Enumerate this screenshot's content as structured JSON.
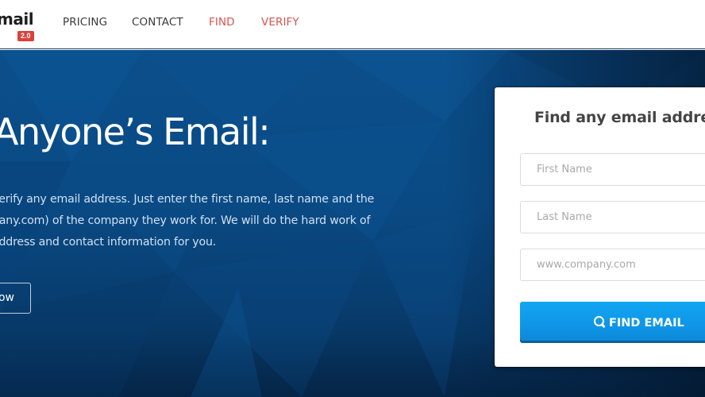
{
  "header": {
    "logo": {
      "text": "mail",
      "badge": "2.0"
    },
    "nav": [
      {
        "label": "PRICING",
        "accent": false
      },
      {
        "label": "CONTACT",
        "accent": false
      },
      {
        "label": "FIND",
        "accent": true
      },
      {
        "label": "VERIFY",
        "accent": true
      }
    ]
  },
  "hero": {
    "title": "Anyone’s Email:",
    "description": [
      "verify any email address. Just enter the first name, last name and the",
      "pany.com) of the company they work for. We will do the hard work of",
      "address and contact information for you."
    ],
    "cta_label": "ow"
  },
  "form": {
    "title": "Find any email address n",
    "first_name": {
      "placeholder": "First Name",
      "value": ""
    },
    "last_name": {
      "placeholder": "Last Name",
      "value": ""
    },
    "domain": {
      "placeholder": "www.company.com",
      "value": ""
    },
    "submit_label": "FIND EMAIL",
    "submit_icon": "search-icon"
  },
  "colors": {
    "accent_red": "#d9534f",
    "badge_red": "#d9423b",
    "hero_blue": "#0b4f8b",
    "button_blue": "#12a6f2"
  }
}
